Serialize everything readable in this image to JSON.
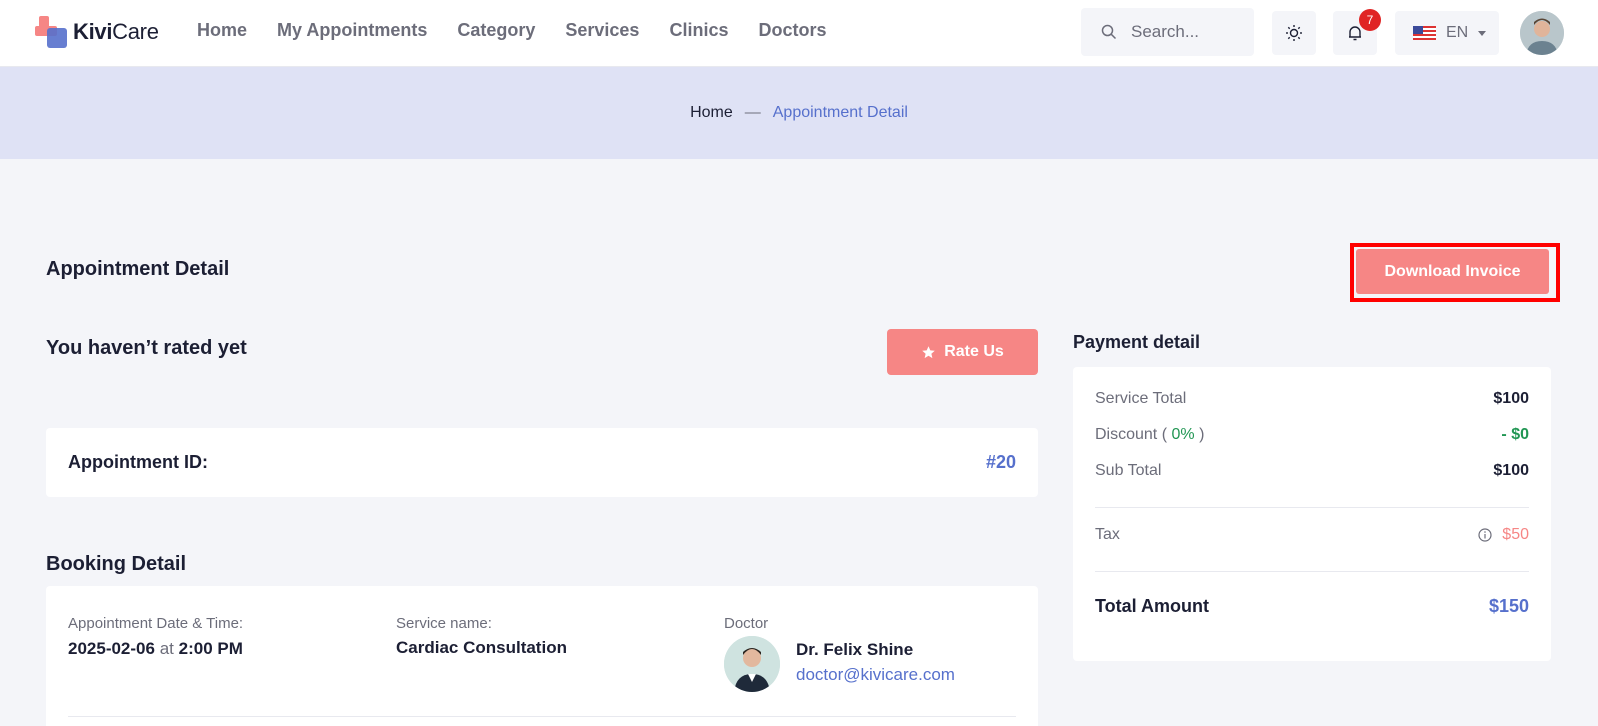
{
  "brand": {
    "name_bold": "Kivi",
    "name_rest": "Care"
  },
  "nav": [
    {
      "label": "Home"
    },
    {
      "label": "My Appointments"
    },
    {
      "label": "Category"
    },
    {
      "label": "Services"
    },
    {
      "label": "Clinics"
    },
    {
      "label": "Doctors"
    }
  ],
  "search": {
    "placeholder": "Search..."
  },
  "notifications": {
    "count": "7"
  },
  "language": {
    "label": "EN"
  },
  "breadcrumb": {
    "home": "Home",
    "separator": "—",
    "current": "Appointment Detail"
  },
  "page": {
    "title": "Appointment Detail",
    "download_invoice": "Download Invoice"
  },
  "rating": {
    "title": "You haven’t rated yet",
    "button": "Rate Us"
  },
  "appointment": {
    "id_label": "Appointment ID:",
    "id_value": "#20"
  },
  "booking": {
    "title": "Booking Detail",
    "datetime_label": "Appointment Date & Time:",
    "date": "2025-02-06",
    "at": "at",
    "time": "2:00 PM",
    "service_label": "Service name:",
    "service": "Cardiac Consultation",
    "doctor_label": "Doctor",
    "doctor_name": "Dr. Felix Shine",
    "doctor_email": "doctor@kivicare.com"
  },
  "payment": {
    "title": "Payment detail",
    "service_total_label": "Service Total",
    "service_total": "$100",
    "discount_label": "Discount",
    "discount_open": "(",
    "discount_pct": "0%",
    "discount_close": ")",
    "discount": "- $0",
    "subtotal_label": "Sub Total",
    "subtotal": "$100",
    "tax_label": "Tax",
    "tax": "$50",
    "total_label": "Total Amount",
    "total": "$150"
  },
  "colors": {
    "primary": "#5670cc",
    "accent": "#f68685",
    "success": "#219653",
    "highlight_frame": "#ff0000"
  }
}
